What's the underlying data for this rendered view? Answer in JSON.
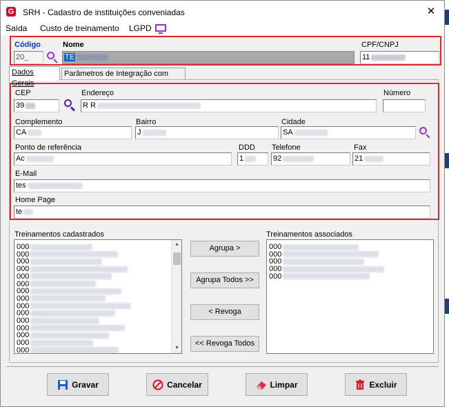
{
  "window": {
    "title": "SRH - Cadastro de instituições conveniadas",
    "close_glyph": "✕",
    "logo_letter": "G"
  },
  "menu": {
    "items": [
      "Saída",
      "Custo de treinamento",
      "LGPD"
    ]
  },
  "header": {
    "codigo_label": "Código",
    "codigo_value": "20_",
    "nome_label": "Nome",
    "nome_value": "TE",
    "cpf_label": "CPF/CNPJ",
    "cpf_value": "11"
  },
  "tabs": [
    "Dados Gerais",
    "Parâmetros de Integração com CPG"
  ],
  "form": {
    "cep_label": "CEP",
    "cep_value": "39",
    "endereco_label": "Endereço",
    "endereco_value": "R R",
    "numero_label": "Número",
    "numero_value": "",
    "complemento_label": "Complemento",
    "complemento_value": "CA",
    "bairro_label": "Bairro",
    "bairro_value": "J",
    "cidade_label": "Cidade",
    "cidade_value": "SA",
    "ponto_label": "Ponto de referência",
    "ponto_value": "Ac",
    "ddd_label": "DDD",
    "ddd_value": "1",
    "telefone_label": "Telefone",
    "telefone_value": "92",
    "fax_label": "Fax",
    "fax_value": "21",
    "email_label": "E-Mail",
    "email_value": "tes",
    "homepage_label": "Home Page",
    "homepage_value": "te"
  },
  "lists": {
    "cadastrados_label": "Treinamentos cadastrados",
    "associados_label": "Treinamentos associados",
    "cadastrados_items": [
      "000",
      "000",
      "000",
      "000",
      "000",
      "000",
      "000",
      "000",
      "000",
      "000",
      "000",
      "000",
      "000",
      "000",
      "000"
    ],
    "associados_items": [
      "000",
      "000",
      "000",
      "000",
      "000"
    ]
  },
  "transfer_buttons": {
    "agrupa": "Agrupa >",
    "agrupa_todos": "Agrupa Todos >>",
    "revoga": "< Revoga",
    "revoga_todos": "<< Revoga Todos"
  },
  "actions": {
    "gravar": "Gravar",
    "cancelar": "Cancelar",
    "limpar": "Limpar",
    "excluir": "Excluir"
  },
  "colors": {
    "accent_purple": "#9b2fc9",
    "highlight_red": "#e3262b",
    "selection_blue": "#0a62d0"
  }
}
